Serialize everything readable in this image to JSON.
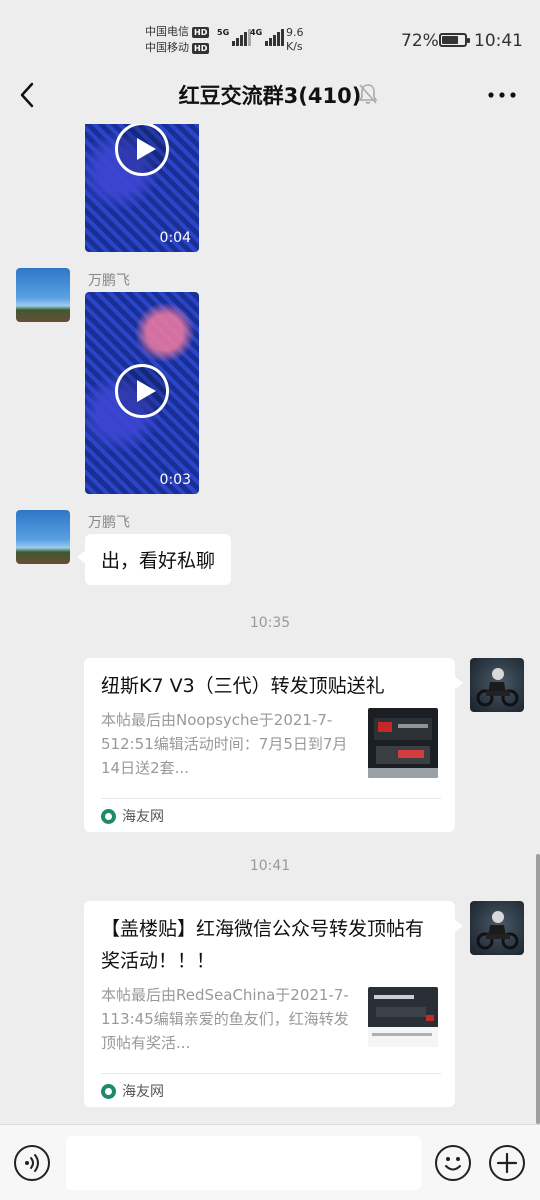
{
  "status_bar": {
    "carrier1": "中国电信",
    "carrier2": "中国移动",
    "hd_label": "HD",
    "signal1_label": "5G",
    "signal2_label": "4G",
    "net_speed_value": "9.6",
    "net_speed_unit": "K/s",
    "battery_percent": "72%",
    "battery_level": 0.72,
    "time": "10:41"
  },
  "header": {
    "title": "红豆交流群3(410)",
    "muted": true
  },
  "messages": [
    {
      "type": "video",
      "duration": "0:04"
    },
    {
      "type": "video",
      "sender": "万鹏飞",
      "duration": "0:03"
    },
    {
      "type": "text",
      "sender": "万鹏飞",
      "text": "出，看好私聊"
    },
    {
      "type": "timestamp",
      "text": "10:35"
    },
    {
      "type": "link_card",
      "title": "纽斯K7 V3（三代）转发顶贴送礼",
      "desc": "本帖最后由Noopsyche于2021-7-512:51编辑活动时间：7月5日到7月14日送2套...",
      "source": "海友网"
    },
    {
      "type": "timestamp",
      "text": "10:41"
    },
    {
      "type": "link_card",
      "title": "【盖楼贴】红海微信公众号转发顶帖有奖活动！！！",
      "desc": "本帖最后由RedSeaChina于2021-7-113:45编辑亲爱的鱼友们，红海转发顶帖有奖活...",
      "source": "海友网"
    }
  ],
  "input_bar": {
    "placeholder": ""
  },
  "icons": {
    "back": "chevron-left-icon",
    "mute": "bell-off-icon",
    "more": "more-dots-icon",
    "voice": "voice-icon",
    "emoji": "emoji-icon",
    "plus": "plus-icon"
  },
  "colors": {
    "background": "#ededed",
    "bubble": "#ffffff",
    "source_icon": "#1e8a6b"
  }
}
